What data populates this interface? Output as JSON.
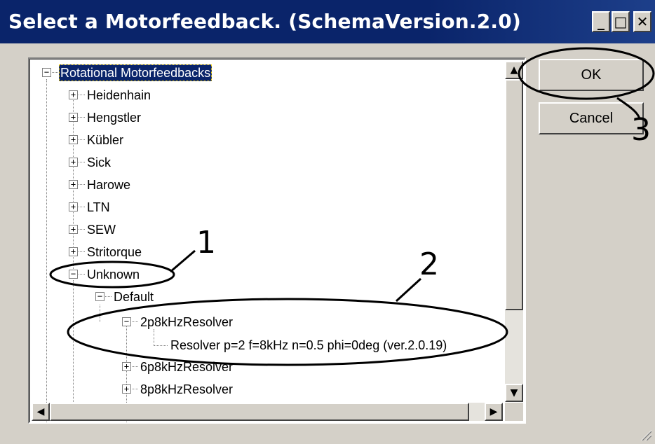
{
  "window": {
    "title": "Select a Motorfeedback. (SchemaVersion.2.0)",
    "controls": {
      "minimize": "_",
      "maximize": "□",
      "close": "✕"
    }
  },
  "tree": {
    "root": {
      "label": "Rotational Motorfeedbacks",
      "expander": "−",
      "selected": true
    },
    "items": [
      {
        "label": "Heidenhain",
        "expander": "+"
      },
      {
        "label": "Hengstler",
        "expander": "+"
      },
      {
        "label": "Kübler",
        "expander": "+"
      },
      {
        "label": "Sick",
        "expander": "+"
      },
      {
        "label": "Harowe",
        "expander": "+"
      },
      {
        "label": "LTN",
        "expander": "+"
      },
      {
        "label": "SEW",
        "expander": "+"
      },
      {
        "label": "Stritorque",
        "expander": "+"
      },
      {
        "label": "Unknown",
        "expander": "−"
      }
    ],
    "unknown_children": [
      {
        "label": "Default",
        "expander": "−"
      }
    ],
    "default_children": [
      {
        "label": "2p8kHzResolver",
        "expander": "−"
      },
      {
        "label": "6p8kHzResolver",
        "expander": "+"
      },
      {
        "label": "8p8kHzResolver",
        "expander": "+"
      }
    ],
    "resolver_leaf": {
      "label": "Resolver p=2 f=8kHz n=0.5 phi=0deg (ver.2.0.19)"
    }
  },
  "buttons": {
    "ok": "OK",
    "cancel": "Cancel"
  },
  "annotations": {
    "n1": "1",
    "n2": "2",
    "n3": "3"
  },
  "scroll_arrows": {
    "up": "▲",
    "down": "▼",
    "left": "◀",
    "right": "▶"
  }
}
